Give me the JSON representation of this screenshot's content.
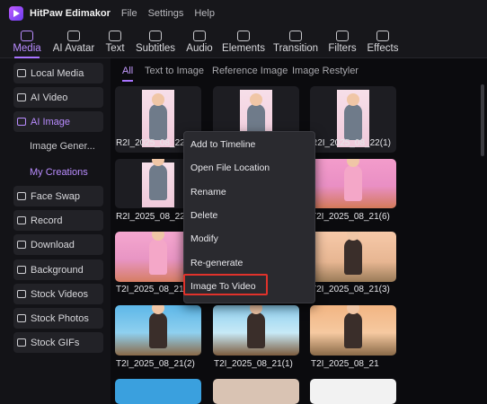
{
  "app": {
    "title": "HitPaw Edimakor",
    "menu": [
      "File",
      "Settings",
      "Help"
    ]
  },
  "toolbar": {
    "items": [
      {
        "label": "Media",
        "icon": "media-icon"
      },
      {
        "label": "AI Avatar",
        "icon": "avatar-icon"
      },
      {
        "label": "Text",
        "icon": "text-icon"
      },
      {
        "label": "Subtitles",
        "icon": "subtitles-icon"
      },
      {
        "label": "Audio",
        "icon": "audio-icon"
      },
      {
        "label": "Elements",
        "icon": "elements-icon"
      },
      {
        "label": "Transition",
        "icon": "transition-icon"
      },
      {
        "label": "Filters",
        "icon": "filters-icon"
      },
      {
        "label": "Effects",
        "icon": "effects-icon"
      }
    ],
    "active": "Media"
  },
  "sidebar": {
    "items": [
      {
        "label": "Local Media",
        "icon": "folder-icon"
      },
      {
        "label": "AI Video",
        "icon": "video-icon"
      },
      {
        "label": "AI Image",
        "icon": "image-icon",
        "active": true
      },
      {
        "label": "Face Swap",
        "icon": "face-icon"
      },
      {
        "label": "Record",
        "icon": "record-icon"
      },
      {
        "label": "Download",
        "icon": "download-icon"
      },
      {
        "label": "Background",
        "icon": "background-icon"
      },
      {
        "label": "Stock Videos",
        "icon": "stock-video-icon"
      },
      {
        "label": "Stock Photos",
        "icon": "stock-photo-icon"
      },
      {
        "label": "Stock GIFs",
        "icon": "gif-icon"
      }
    ],
    "subitems": [
      {
        "label": "Image Gener..."
      },
      {
        "label": "My Creations",
        "active": true
      }
    ]
  },
  "tabs": [
    "All",
    "Text to Image",
    "Reference Image",
    "Image Restyler"
  ],
  "grid": [
    {
      "caption": "R2I_2025_08_22(3",
      "kind": "doll"
    },
    {
      "caption": "",
      "kind": "doll"
    },
    {
      "caption": "R2I_2025_08_22(1)",
      "kind": "doll"
    },
    {
      "caption": "R2I_2025_08_22",
      "kind": "doll"
    },
    {
      "caption": "",
      "kind": "none"
    },
    {
      "caption": "T2I_2025_08_21(6)",
      "kind": "candy"
    },
    {
      "caption": "T2I_2025_08_21(5",
      "kind": "candy"
    },
    {
      "caption": "",
      "kind": "none"
    },
    {
      "caption": "T2I_2025_08_21(3)",
      "kind": "pirate"
    },
    {
      "caption": "T2I_2025_08_21(2)",
      "kind": "pirate"
    },
    {
      "caption": "T2I_2025_08_21(1)",
      "kind": "pirate"
    },
    {
      "caption": "T2I_2025_08_21",
      "kind": "pirate"
    }
  ],
  "context_menu": {
    "items": [
      "Add to Timeline",
      "Open File Location",
      "Rename",
      "Delete",
      "Modify",
      "Re-generate",
      "Image To Video"
    ],
    "highlighted": "Image To Video"
  }
}
